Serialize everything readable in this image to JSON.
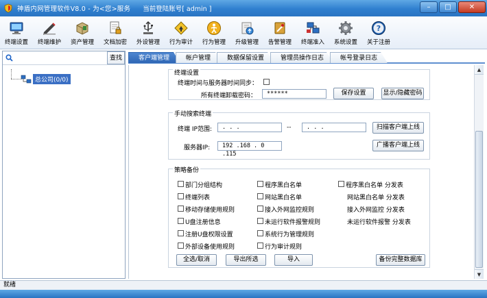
{
  "window": {
    "title": "神盾内网管理软件V8.0 - 为<您>服务",
    "account": "当前登陆账号[ admin ]",
    "minimize": "–",
    "maximize": "□",
    "close": "✕"
  },
  "toolbar": {
    "items": [
      {
        "label": "终端设置",
        "icon": "monitor-icon"
      },
      {
        "label": "终端维护",
        "icon": "pen-icon"
      },
      {
        "label": "资产管理",
        "icon": "box-icon"
      },
      {
        "label": "文档加密",
        "icon": "document-lock-icon"
      },
      {
        "label": "外设管理",
        "icon": "usb-icon"
      },
      {
        "label": "行为审计",
        "icon": "warning-icon"
      },
      {
        "label": "行为管理",
        "icon": "person-icon"
      },
      {
        "label": "升级管理",
        "icon": "upgrade-icon"
      },
      {
        "label": "告警管理",
        "icon": "alarm-icon"
      },
      {
        "label": "终端准入",
        "icon": "network-icon"
      },
      {
        "label": "系统设置",
        "icon": "gear-icon"
      },
      {
        "label": "关于注册",
        "icon": "help-icon"
      }
    ]
  },
  "left": {
    "search_button": "查找",
    "tree_root": "总公司(0/0)"
  },
  "tabs": [
    "客户端管理",
    "帐户管理",
    "数据保留设置",
    "管理员操作日志",
    "帐号登录日志"
  ],
  "terminal_settings": {
    "title": "终端设置",
    "sync_label": "终端时间与服务器时间同步：",
    "password_label": "所有终端卸载密码：",
    "password_value": "******",
    "save_button": "保存设置",
    "show_hide_button": "显示/隐藏密码"
  },
  "manual_search": {
    "title": "手动搜索终端",
    "ip_range_label": "终端 IP范围:",
    "ip_start": "  .   .   .",
    "separator": "--",
    "ip_end": "  .   .   .",
    "scan_button": "扫描客户端上线",
    "server_ip_label": "服务器IP:",
    "server_ip": "192 .168 . 0  .115",
    "broadcast_button": "广播客户端上线"
  },
  "policy_backup": {
    "title": "策略备份",
    "col1": [
      "部门分组结构",
      "终端列表",
      "移动存储使用规则",
      "U盘注册信息",
      "注册U盘权限设置",
      "外部设备使用规则"
    ],
    "col2": [
      "程序黑白名单",
      "网站黑白名单",
      "接入外网监控规则",
      "未运行软件报警规则",
      "系统行为管理规则",
      "行为审计规则"
    ],
    "col3": [
      "程序黑白名单  分发表",
      "网站黑白名单  分发表",
      "接入外网监控  分发表",
      "未运行软件报警  分发表"
    ],
    "select_all_button": "全选/取消",
    "export_button": "导出所选",
    "import_button": "导入",
    "full_backup_button": "备份完整数据库"
  },
  "status": "就绪"
}
